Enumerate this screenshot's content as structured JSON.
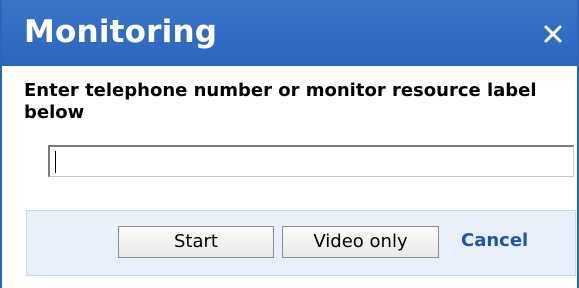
{
  "dialog": {
    "title": "Monitoring",
    "close_icon": "close-icon",
    "prompt": "Enter telephone number or monitor resource label below",
    "input": {
      "value": "",
      "placeholder": ""
    },
    "buttons": {
      "start_label": "Start",
      "video_only_label": "Video only",
      "cancel_label": "Cancel"
    }
  },
  "colors": {
    "titlebar": "#2c65bd",
    "footer_background": "#eaf0fb",
    "link": "#2454a8"
  }
}
